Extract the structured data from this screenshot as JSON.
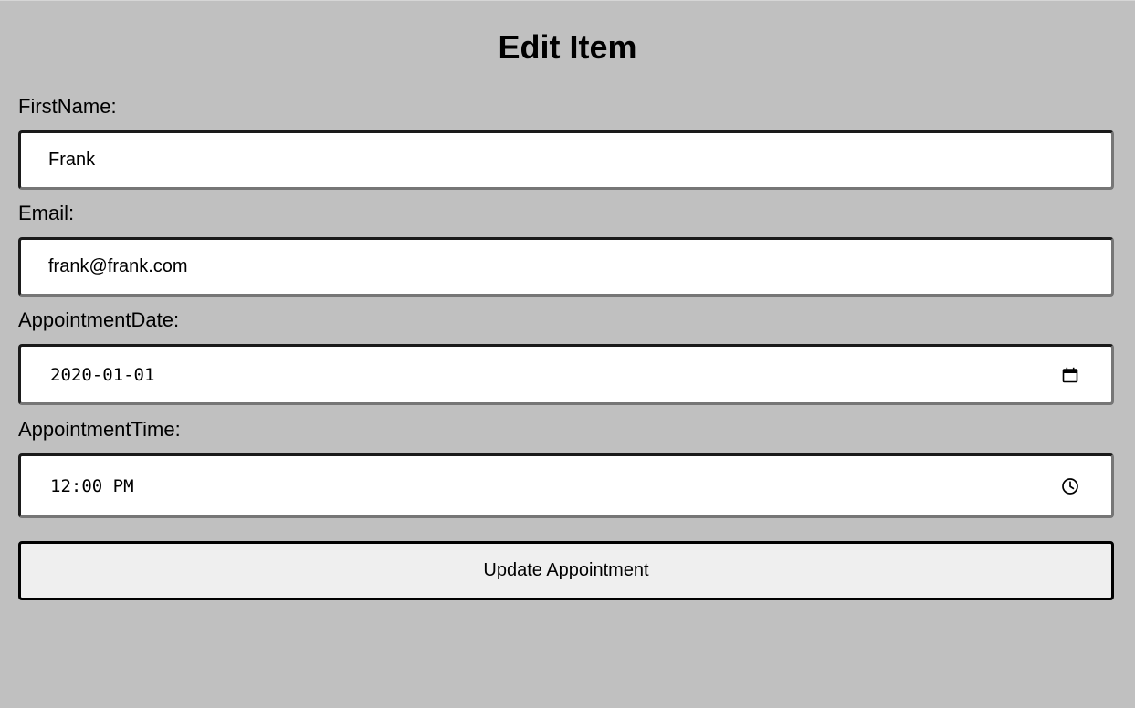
{
  "page": {
    "title": "Edit Item"
  },
  "form": {
    "first_name": {
      "label": "FirstName:",
      "value": "Frank"
    },
    "email": {
      "label": "Email:",
      "value": "frank@frank.com"
    },
    "appointment_date": {
      "label": "AppointmentDate:",
      "value": "2020-01-01",
      "icon": "calendar-icon"
    },
    "appointment_time": {
      "label": "AppointmentTime:",
      "value": "12:00 PM",
      "icon": "clock-icon"
    },
    "submit_label": "Update Appointment"
  },
  "colors": {
    "background": "#c0c0c0",
    "input_background": "#ffffff",
    "button_background": "#efefef"
  }
}
